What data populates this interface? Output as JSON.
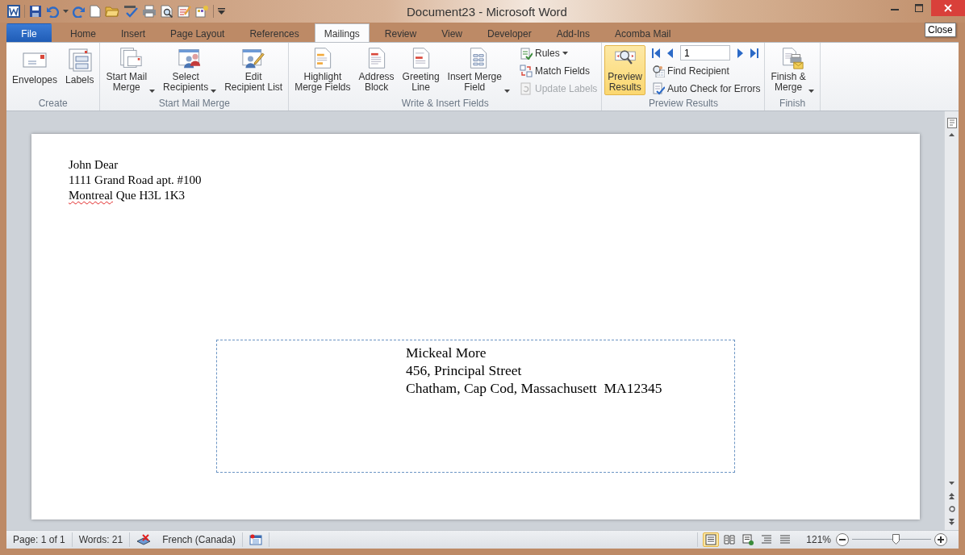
{
  "window": {
    "title": "Document23 - Microsoft Word",
    "tooltip": "Close"
  },
  "tabs": [
    {
      "label": "File",
      "kind": "file",
      "selected": false
    },
    {
      "label": "Home",
      "kind": "tab",
      "selected": false
    },
    {
      "label": "Insert",
      "kind": "tab",
      "selected": false
    },
    {
      "label": "Page Layout",
      "kind": "tab",
      "selected": false
    },
    {
      "label": "References",
      "kind": "tab",
      "selected": false
    },
    {
      "label": "Mailings",
      "kind": "tab",
      "selected": true
    },
    {
      "label": "Review",
      "kind": "tab",
      "selected": false
    },
    {
      "label": "View",
      "kind": "tab",
      "selected": false
    },
    {
      "label": "Developer",
      "kind": "tab",
      "selected": false
    },
    {
      "label": "Add-Ins",
      "kind": "tab",
      "selected": false
    },
    {
      "label": "Acomba Mail",
      "kind": "tab",
      "selected": false
    }
  ],
  "ribbon": {
    "groups": [
      {
        "label": "Create",
        "items": [
          {
            "kind": "large",
            "label": "Envelopes",
            "dropdown": false
          },
          {
            "kind": "large",
            "label": "Labels",
            "dropdown": false
          }
        ]
      },
      {
        "label": "Start Mail Merge",
        "items": [
          {
            "kind": "large",
            "label": "Start Mail\nMerge",
            "dropdown": true
          },
          {
            "kind": "large",
            "label": "Select\nRecipients",
            "dropdown": true
          },
          {
            "kind": "large",
            "label": "Edit\nRecipient List",
            "dropdown": false
          }
        ]
      },
      {
        "label": "Write & Insert Fields",
        "items": [
          {
            "kind": "large",
            "label": "Highlight\nMerge Fields",
            "dropdown": false
          },
          {
            "kind": "large",
            "label": "Address\nBlock",
            "dropdown": false
          },
          {
            "kind": "large",
            "label": "Greeting\nLine",
            "dropdown": false
          },
          {
            "kind": "large",
            "label": "Insert Merge\nField",
            "dropdown": true
          },
          {
            "kind": "stack",
            "items": [
              {
                "label": "Rules",
                "dropdown": true,
                "disabled": false
              },
              {
                "label": "Match Fields",
                "dropdown": false,
                "disabled": false
              },
              {
                "label": "Update Labels",
                "dropdown": false,
                "disabled": true
              }
            ]
          }
        ]
      },
      {
        "label": "Preview Results",
        "items": [
          {
            "kind": "toggle",
            "label": "Preview\nResults",
            "on": true
          },
          {
            "kind": "record_nav",
            "record": "1",
            "items": [
              {
                "label": "Find Recipient",
                "dropdown": false,
                "disabled": false
              },
              {
                "label": "Auto Check for Errors",
                "dropdown": false,
                "disabled": false
              }
            ]
          }
        ]
      },
      {
        "label": "Finish",
        "items": [
          {
            "kind": "large",
            "label": "Finish &\nMerge",
            "dropdown": true
          }
        ]
      }
    ]
  },
  "document": {
    "return_address": [
      {
        "parts": [
          {
            "text": "John Dear",
            "misspelled": false
          }
        ]
      },
      {
        "parts": [
          {
            "text": "1111 Grand Road apt. #100",
            "misspelled": false
          }
        ]
      },
      {
        "parts": [
          {
            "text": "Montreal",
            "misspelled": true
          },
          {
            "text": " Que H3L 1K3",
            "misspelled": false
          }
        ]
      }
    ],
    "recipient_address": [
      "Mickeal More",
      "456, Principal Street",
      "Chatham, Cap Cod, Massachusett  MA12345"
    ]
  },
  "status_bar": {
    "page": "Page: 1 of 1",
    "words": "Words: 21",
    "language": "French (Canada)",
    "views": [
      {
        "selected": true
      },
      {
        "selected": false
      },
      {
        "selected": false
      },
      {
        "selected": false
      },
      {
        "selected": false
      }
    ],
    "zoom": {
      "reading": "121%",
      "level": 0.55
    }
  }
}
